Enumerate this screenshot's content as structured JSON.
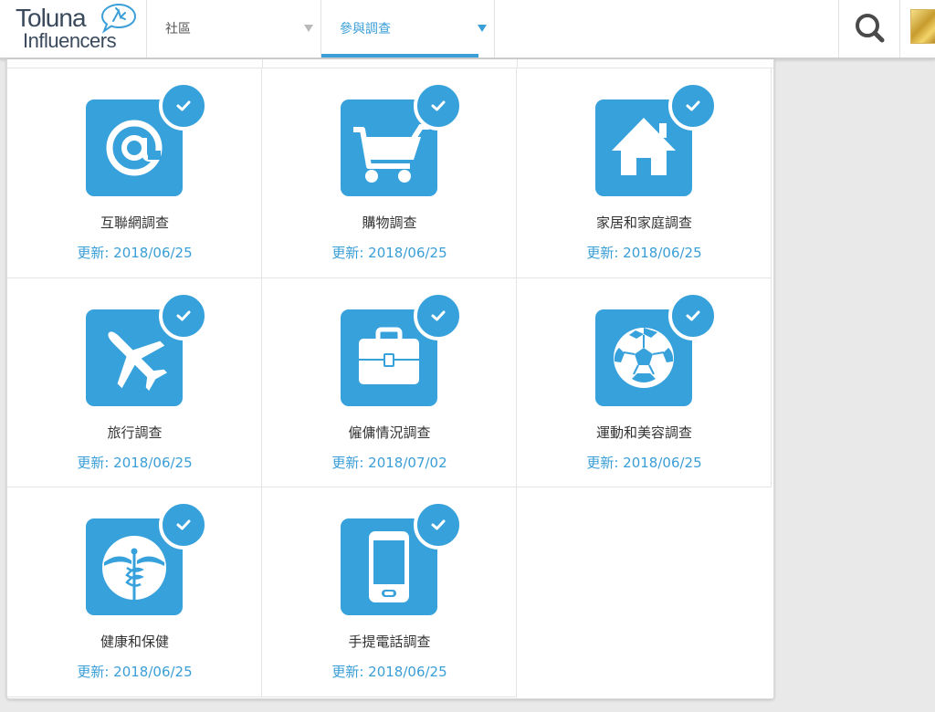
{
  "header": {
    "logo": {
      "line1": "Toluna",
      "line2": "Influencers"
    },
    "nav": [
      {
        "label": "社區",
        "active": false
      },
      {
        "label": "參與調查",
        "active": true
      }
    ],
    "search_icon": "search-icon",
    "avatar_icon": "user-avatar"
  },
  "colors": {
    "accent": "#37a1dc",
    "link": "#3a9ed7"
  },
  "surveys": [
    {
      "title": "互聯網調查",
      "date": "更新: 2018/06/25",
      "icon": "at-sign-icon",
      "completed": true
    },
    {
      "title": "購物調查",
      "date": "更新: 2018/06/25",
      "icon": "shopping-cart-icon",
      "completed": true
    },
    {
      "title": "家居和家庭調查",
      "date": "更新: 2018/06/25",
      "icon": "house-icon",
      "completed": true
    },
    {
      "title": "旅行調查",
      "date": "更新: 2018/06/25",
      "icon": "airplane-icon",
      "completed": true
    },
    {
      "title": "僱傭情況調查",
      "date": "更新: 2018/07/02",
      "icon": "briefcase-icon",
      "completed": true
    },
    {
      "title": "運動和美容調查",
      "date": "更新: 2018/06/25",
      "icon": "soccer-ball-icon",
      "completed": true
    },
    {
      "title": "健康和保健",
      "date": "更新: 2018/06/25",
      "icon": "caduceus-icon",
      "completed": true
    },
    {
      "title": "手提電話調查",
      "date": "更新: 2018/06/25",
      "icon": "mobile-phone-icon",
      "completed": true
    }
  ]
}
